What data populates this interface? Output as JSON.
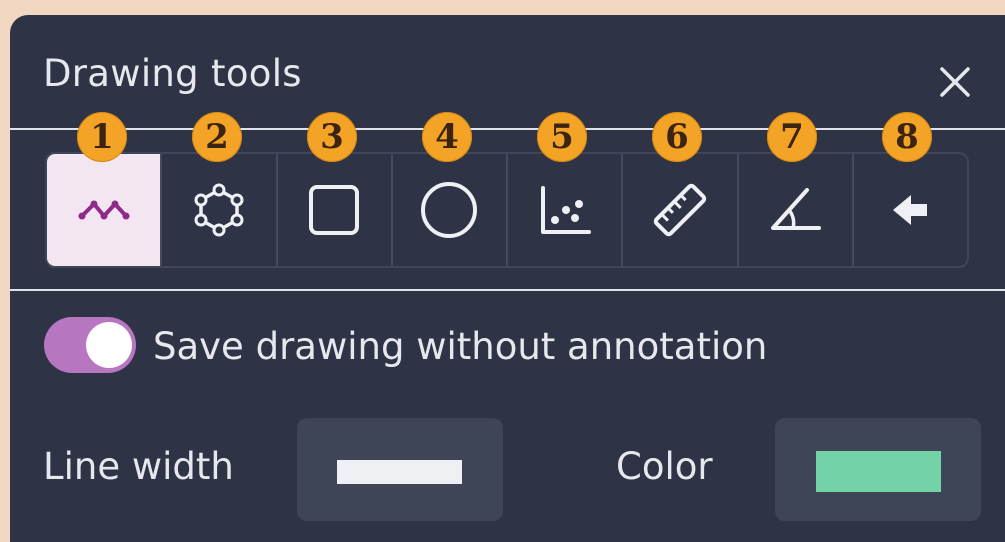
{
  "panel": {
    "title": "Drawing tools",
    "close_icon": "close-icon"
  },
  "tools": [
    {
      "id": "polyline",
      "icon": "polyline-icon",
      "badge": "1",
      "active": true
    },
    {
      "id": "polygon",
      "icon": "polygon-icon",
      "badge": "2",
      "active": false
    },
    {
      "id": "rectangle",
      "icon": "rectangle-icon",
      "badge": "3",
      "active": false
    },
    {
      "id": "ellipse",
      "icon": "ellipse-icon",
      "badge": "4",
      "active": false
    },
    {
      "id": "points",
      "icon": "points-icon",
      "badge": "5",
      "active": false
    },
    {
      "id": "ruler",
      "icon": "ruler-icon",
      "badge": "6",
      "active": false
    },
    {
      "id": "angle",
      "icon": "angle-icon",
      "badge": "7",
      "active": false
    },
    {
      "id": "back",
      "icon": "back-arrow-icon",
      "badge": "8",
      "active": false
    }
  ],
  "options": {
    "toggle_label": "Save drawing without annotation",
    "toggle_on": true,
    "line_width_label": "Line width",
    "color_label": "Color",
    "color_value": "#73d3a7"
  },
  "colors": {
    "panel_bg": "#2e3446",
    "accent": "#b776c0",
    "badge": "#f3a326",
    "active_tool_bg": "#f3e6f1"
  }
}
